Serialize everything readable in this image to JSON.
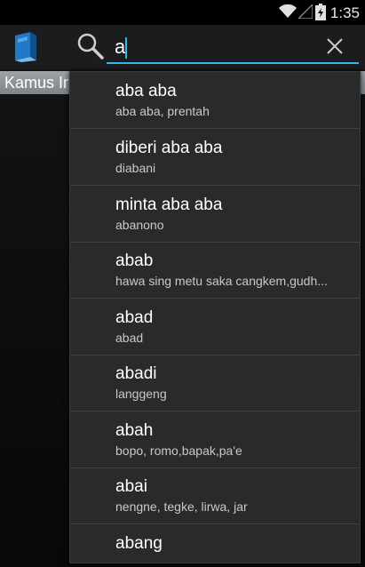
{
  "status_bar": {
    "time": "1:35"
  },
  "search": {
    "query": "a"
  },
  "tab": {
    "label": "Kamus Indonesia"
  },
  "suggestions": [
    {
      "word": "aba aba",
      "meaning": "aba aba, prentah"
    },
    {
      "word": "diberi aba aba",
      "meaning": "diabani"
    },
    {
      "word": "minta aba aba",
      "meaning": "abanono"
    },
    {
      "word": "abab",
      "meaning": "hawa sing metu saka cangkem,gudh..."
    },
    {
      "word": "abad",
      "meaning": "abad"
    },
    {
      "word": "abadi",
      "meaning": "langgeng"
    },
    {
      "word": "abah",
      "meaning": "bopo, romo,bapak,pa'e"
    },
    {
      "word": "abai",
      "meaning": "nengne, tegke, lirwa, jar"
    },
    {
      "word": "abang",
      "meaning": ""
    }
  ],
  "colors": {
    "accent": "#33b5e5",
    "dropdown_bg": "#2a2a2a",
    "status_bar": "#000000"
  }
}
